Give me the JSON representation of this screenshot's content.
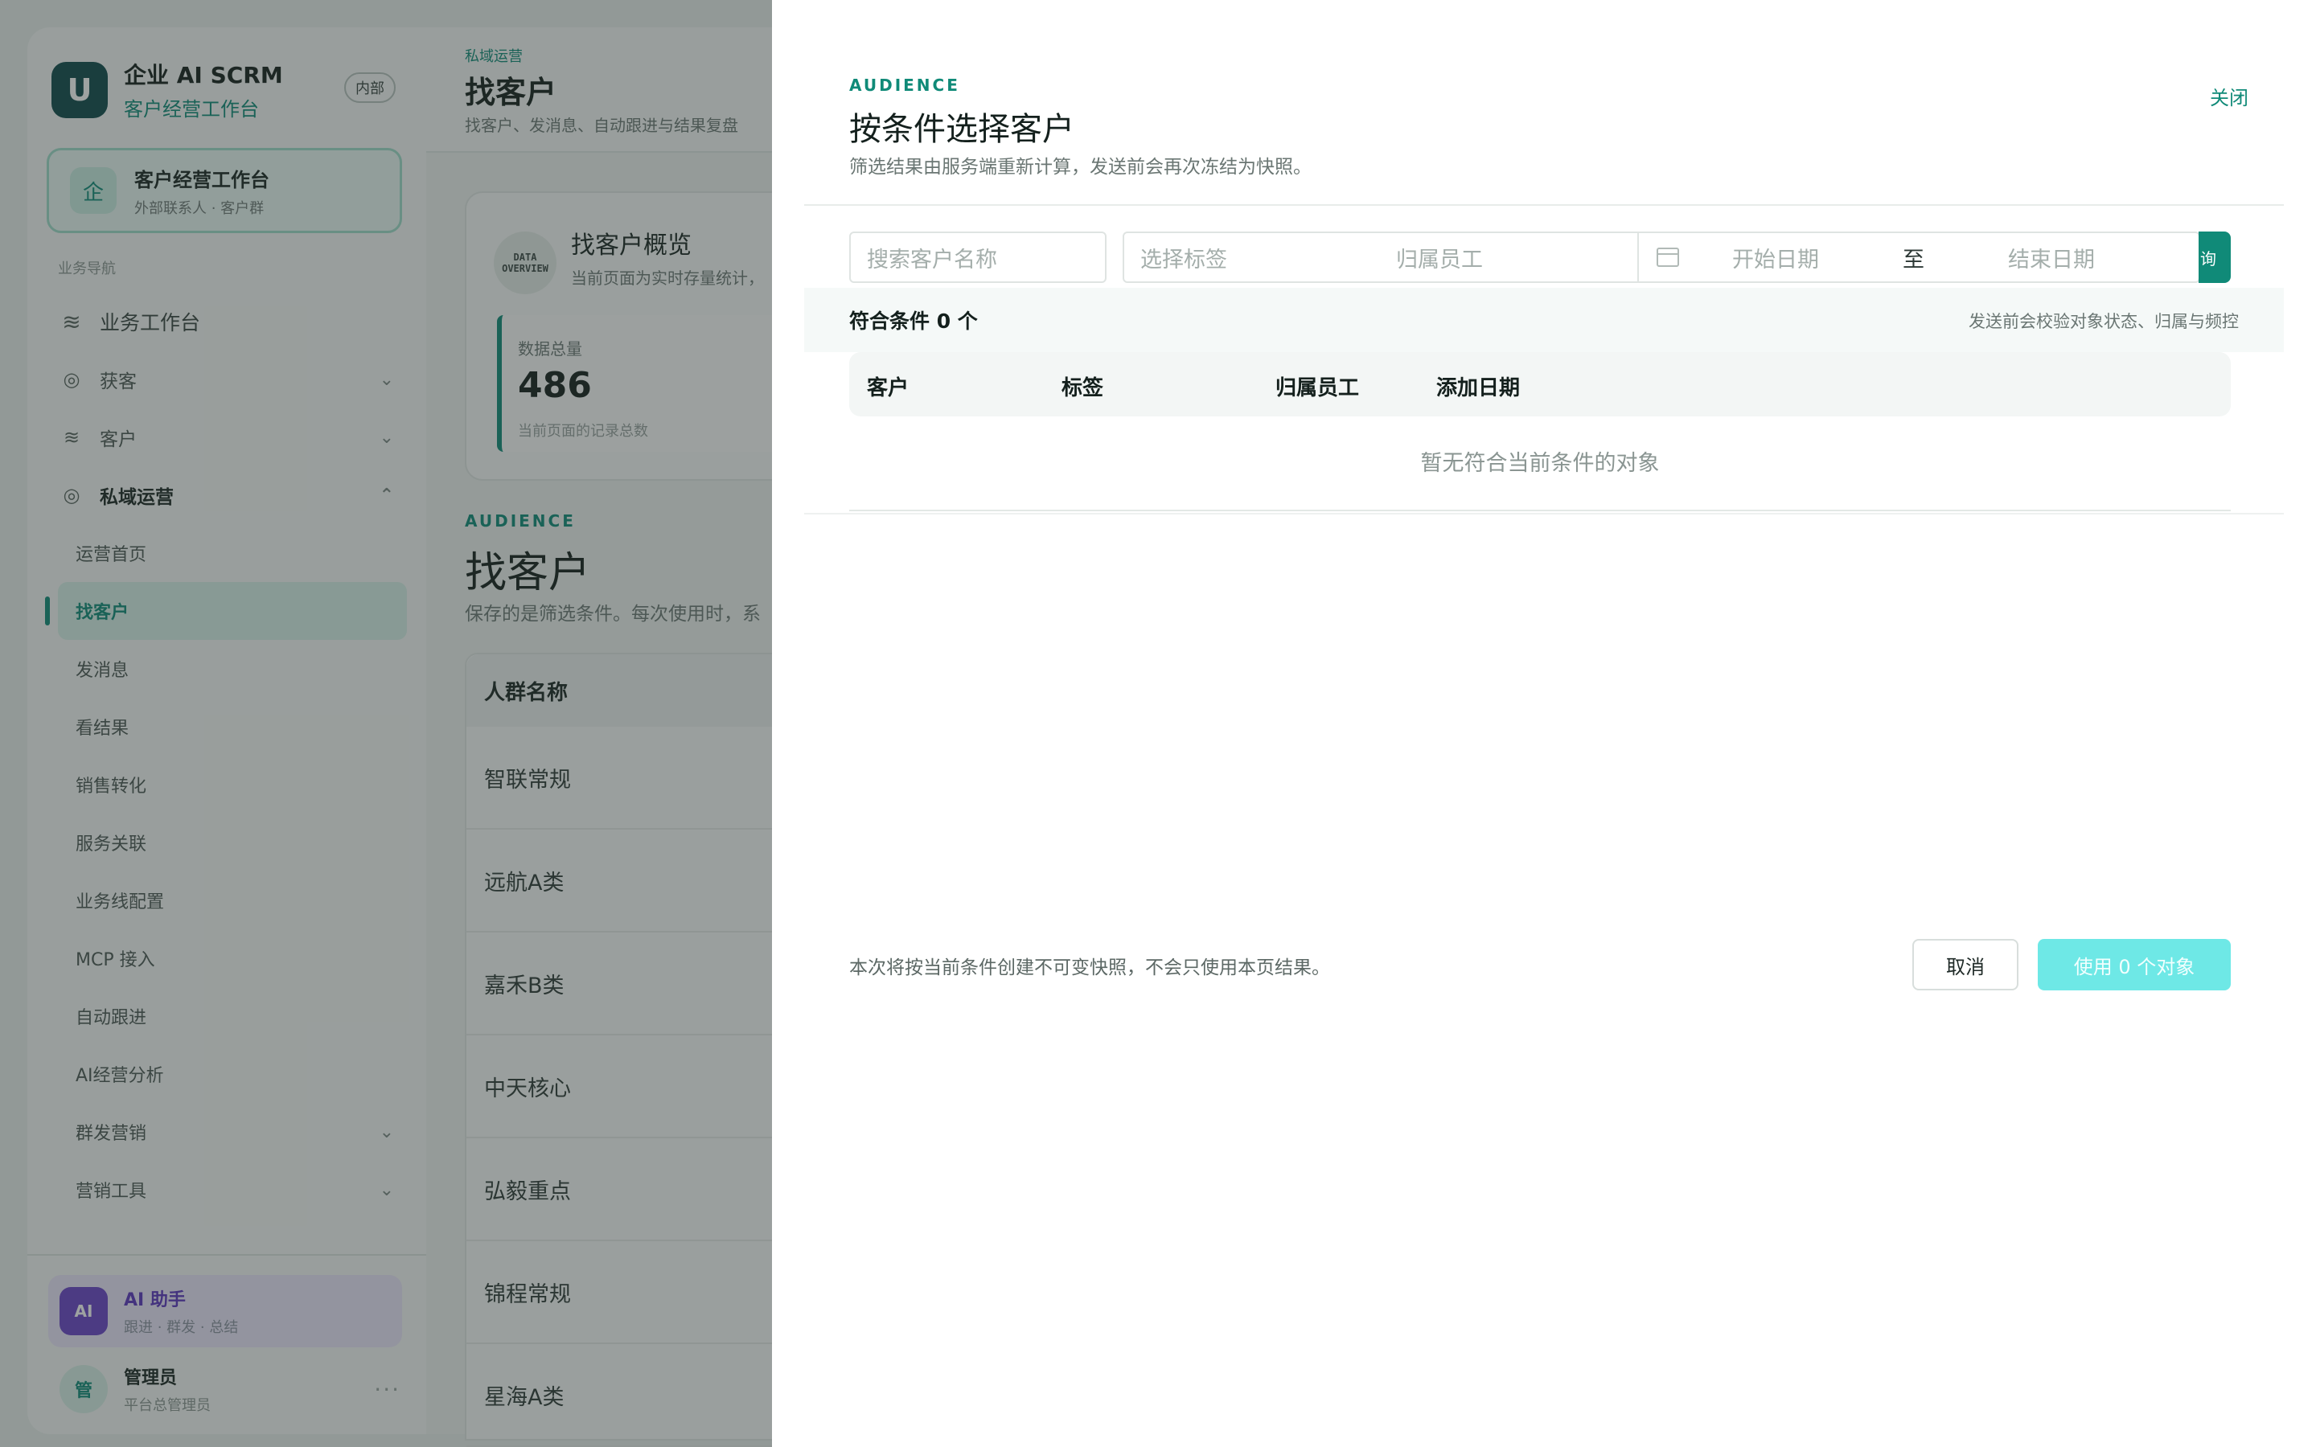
{
  "brand": {
    "logo": "U",
    "name": "企业 AI SCRM",
    "subtitle": "客户经营工作台",
    "tag": "内部"
  },
  "workbench": {
    "icon": "企",
    "title": "客户经营工作台",
    "subtitle": "外部联系人 · 客户群"
  },
  "nav": {
    "section": "业务导航",
    "items": [
      {
        "label": "业务工作台",
        "icon": "layers-icon",
        "level": 1
      },
      {
        "label": "获客",
        "icon": "target-icon",
        "chevron": "down"
      },
      {
        "label": "客户",
        "icon": "layers-icon",
        "chevron": "down"
      },
      {
        "label": "私域运营",
        "icon": "target-icon",
        "chevron": "up",
        "expanded": true
      },
      {
        "label": "运营首页"
      },
      {
        "label": "找客户",
        "active": true
      },
      {
        "label": "发消息"
      },
      {
        "label": "看结果"
      },
      {
        "label": "销售转化"
      },
      {
        "label": "服务关联"
      },
      {
        "label": "业务线配置"
      },
      {
        "label": "MCP 接入"
      },
      {
        "label": "自动跟进"
      },
      {
        "label": "AI经营分析"
      },
      {
        "label": "群发营销",
        "chevron": "down"
      },
      {
        "label": "营销工具",
        "chevron": "down"
      }
    ]
  },
  "ai_assistant": {
    "badge": "AI",
    "title": "AI 助手",
    "subtitle": "跟进 · 群发 · 总结"
  },
  "admin": {
    "avatar": "管",
    "name": "管理员",
    "role": "平台总管理员",
    "more": "···"
  },
  "main": {
    "breadcrumb": "私域运营",
    "title": "找客户",
    "description": "找客户、发消息、自动跟进与结果复盘",
    "overview": {
      "icon_text": "DATA OVERVIEW",
      "title": "找客户概览",
      "description": "当前页面为实时存量统计，",
      "stat_label": "数据总量",
      "stat_value": "486",
      "stat_sub": "当前页面的记录总数"
    },
    "audience": {
      "eyebrow": "AUDIENCE",
      "title": "找客户",
      "description": "保存的是筛选条件。每次使用时，系",
      "table_header": "人群名称",
      "rows": [
        "智联常规",
        "远航A类",
        "嘉禾B类",
        "中天核心",
        "弘毅重点",
        "锦程常规",
        "星海A类"
      ]
    }
  },
  "drawer": {
    "eyebrow": "AUDIENCE",
    "title": "按条件选择客户",
    "description": "筛选结果由服务端重新计算，发送前会再次冻结为快照。",
    "close": "关闭",
    "filters": {
      "search_placeholder": "搜索客户名称",
      "tags_placeholder": "选择标签",
      "owner_placeholder": "归属员工",
      "start_date": "开始日期",
      "range_sep": "至",
      "end_date": "结束日期",
      "query_button": "询"
    },
    "summary": {
      "count_text": "符合条件 0 个",
      "note": "发送前会校验对象状态、归属与频控"
    },
    "table": {
      "columns": [
        "客户",
        "标签",
        "归属员工",
        "添加日期"
      ],
      "empty": "暂无符合当前条件的对象"
    },
    "footer": {
      "note": "本次将按当前条件创建不可变快照，不会只使用本页结果。",
      "cancel": "取消",
      "confirm": "使用 0 个对象"
    }
  },
  "colors": {
    "accent": "#108a78",
    "confirm_disabled": "#6ee8e6",
    "ai": "#6a44c8"
  }
}
